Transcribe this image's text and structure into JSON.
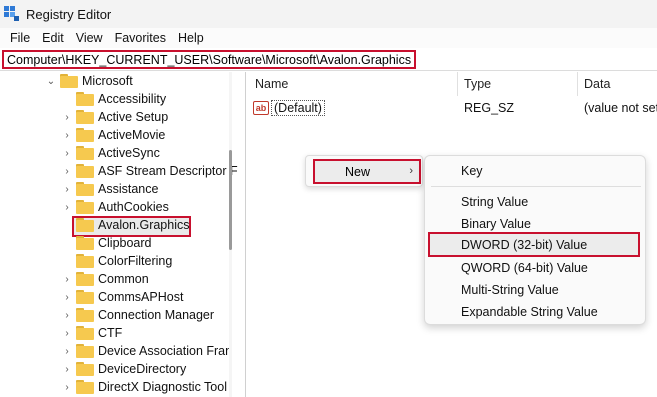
{
  "window": {
    "title": "Registry Editor"
  },
  "menu": [
    "File",
    "Edit",
    "View",
    "Favorites",
    "Help"
  ],
  "address": {
    "path": "Computer\\HKEY_CURRENT_USER\\Software\\Microsoft\\Avalon.Graphics"
  },
  "tree": {
    "parent": "Microsoft",
    "items": [
      "Accessibility",
      "Active Setup",
      "ActiveMovie",
      "ActiveSync",
      "ASF Stream Descriptor F",
      "Assistance",
      "AuthCookies",
      "Avalon.Graphics",
      "Clipboard",
      "ColorFiltering",
      "Common",
      "CommsAPHost",
      "Connection Manager",
      "CTF",
      "Device Association Fran",
      "DeviceDirectory",
      "DirectX Diagnostic Tool"
    ],
    "selected": "Avalon.Graphics"
  },
  "list": {
    "columns": [
      "Name",
      "Type",
      "Data"
    ],
    "rows": [
      {
        "name": "(Default)",
        "type": "REG_SZ",
        "data": "(value not set)"
      }
    ],
    "icon": "ab"
  },
  "context_menu": {
    "label": "New",
    "arrow": "›"
  },
  "submenu": {
    "items": [
      "Key",
      "String Value",
      "Binary Value",
      "DWORD (32-bit) Value",
      "QWORD (64-bit) Value",
      "Multi-String Value",
      "Expandable String Value"
    ],
    "highlighted": "DWORD (32-bit) Value"
  },
  "colors": {
    "highlight_border": "#c8102e",
    "folder": "#f6c94f",
    "icon_blue": "#2f7ad6"
  }
}
